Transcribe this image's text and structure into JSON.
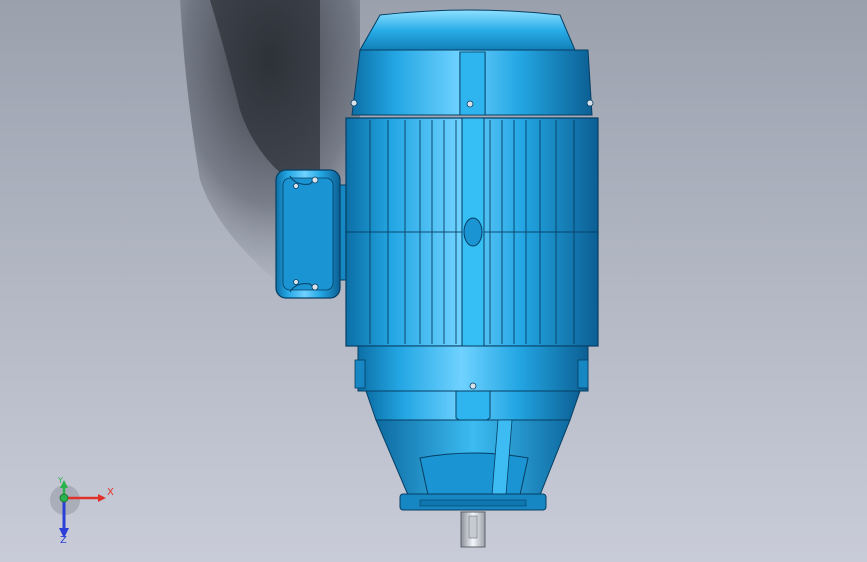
{
  "viewport": {
    "background_top": "#9aa1ad",
    "background_bottom": "#c9ccd8",
    "model": {
      "name": "electric-motor",
      "body_color": "#23a6e3",
      "highlight_color": "#7fd8ff",
      "shadow_color": "#0c6fa6",
      "edge_color": "#063e63"
    }
  },
  "triad": {
    "x_label": "X",
    "y_label": "Y",
    "z_label": "Z",
    "x_color": "#e0322b",
    "y_color": "#2bb24c",
    "z_color": "#2b3fd6"
  }
}
